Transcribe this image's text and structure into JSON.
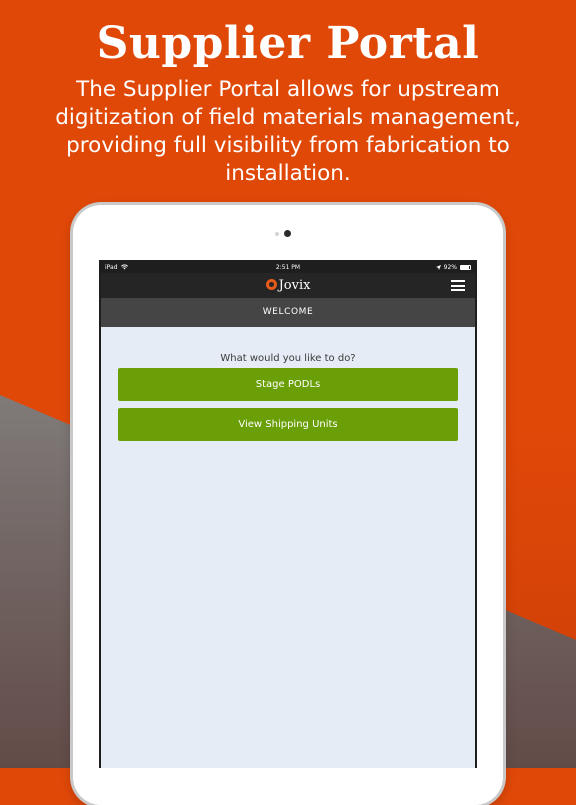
{
  "marketing": {
    "headline": "Supplier Portal",
    "description": "The Supplier Portal allows for upstream digitization of field materials management, providing full visibility from fabrication to installation."
  },
  "status_bar": {
    "device": "iPad",
    "time": "2:51 PM",
    "battery_percent": "92%",
    "battery_level": 0.92
  },
  "app": {
    "logo_text": "Jovix",
    "page_title": "WELCOME",
    "prompt": "What would you like to do?",
    "actions": [
      {
        "label": "Stage PODLs"
      },
      {
        "label": "View Shipping Units"
      }
    ]
  },
  "colors": {
    "brand_orange": "#e04808",
    "action_green": "#6a9f08",
    "header_dark": "#252525",
    "nav_gray": "#454545",
    "screen_bg": "#e5ecf5"
  },
  "icons": {
    "wifi": "wifi-icon",
    "location": "location-arrow-icon",
    "battery": "battery-icon",
    "menu": "hamburger-menu-icon",
    "logo": "jovix-logo-icon"
  }
}
